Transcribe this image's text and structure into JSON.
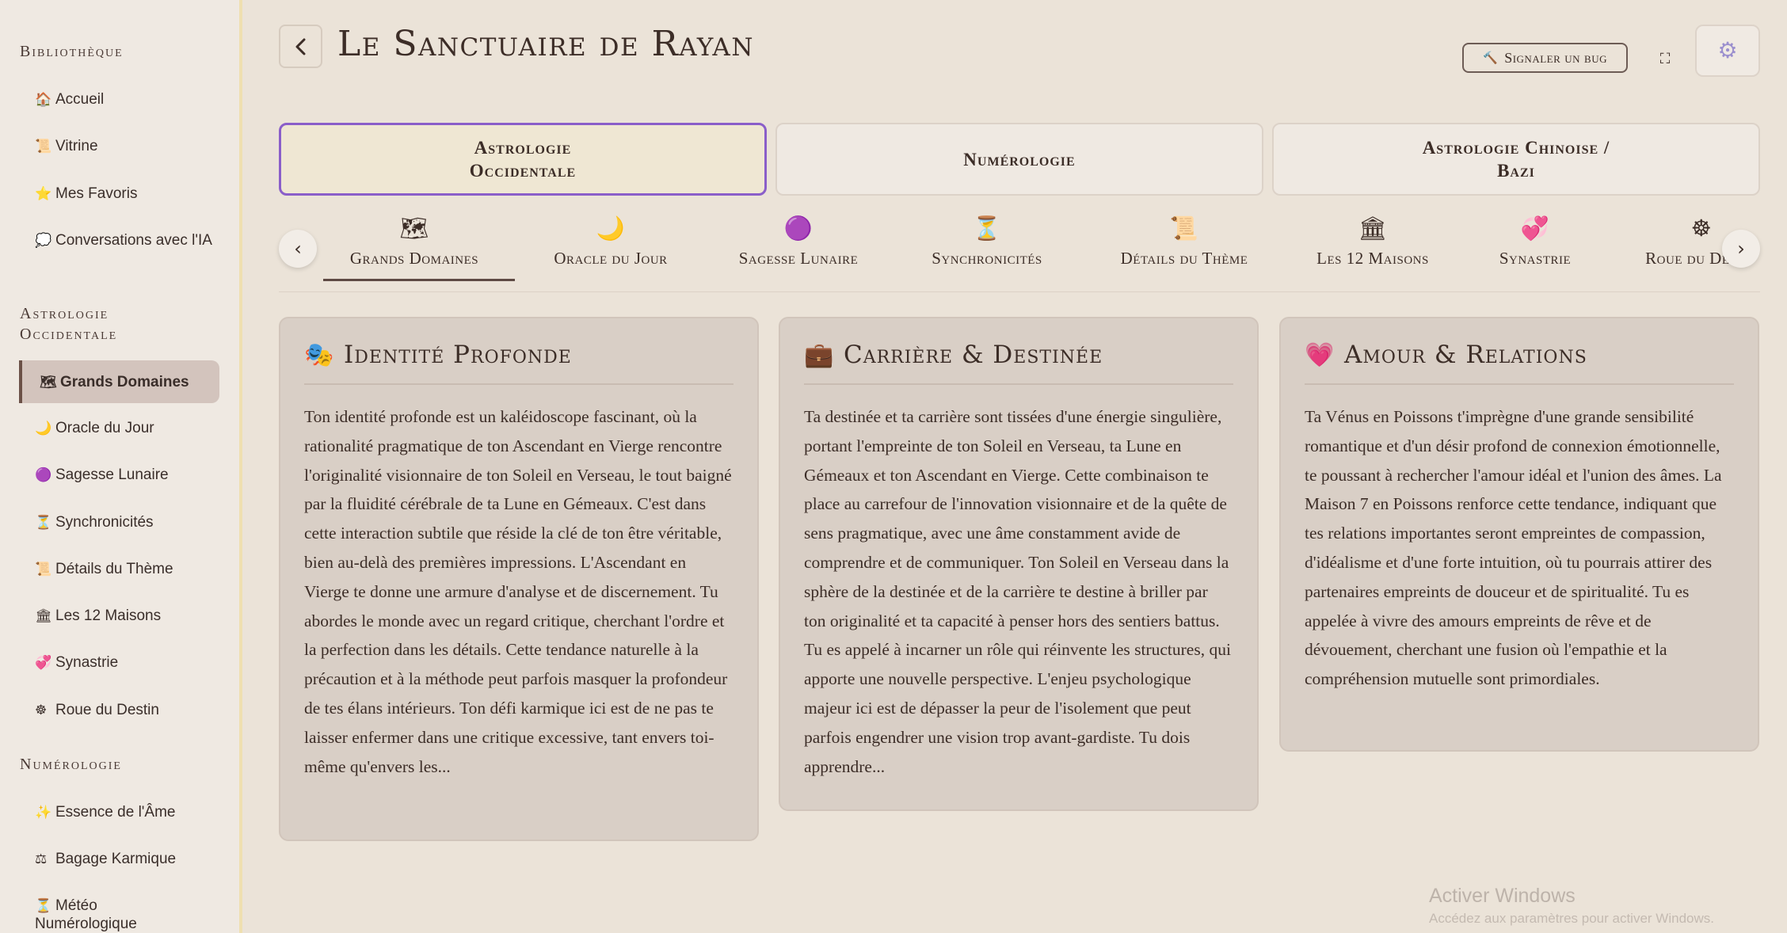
{
  "sidebar": {
    "sections": [
      {
        "title": "Bibliothèque"
      },
      {
        "title": "Astrologie Occidentale"
      },
      {
        "title": "Numérologie"
      }
    ],
    "items": [
      {
        "icon": "🏠",
        "label": "Accueil"
      },
      {
        "icon": "📜",
        "label": "Vitrine"
      },
      {
        "icon": "⭐",
        "label": "Mes Favoris"
      },
      {
        "icon": "💭",
        "label": "Conversations avec l'IA"
      },
      {
        "icon": "🗺",
        "label": "Grands Domaines"
      },
      {
        "icon": "🌙",
        "label": "Oracle du Jour"
      },
      {
        "icon": "🟣",
        "label": "Sagesse Lunaire"
      },
      {
        "icon": "⏳",
        "label": "Synchronicités"
      },
      {
        "icon": "📜",
        "label": "Détails du Thème"
      },
      {
        "icon": "🏛",
        "label": "Les 12 Maisons"
      },
      {
        "icon": "💞",
        "label": "Synastrie"
      },
      {
        "icon": "☸",
        "label": "Roue du Destin"
      },
      {
        "icon": "✨",
        "label": "Essence de l'Âme"
      },
      {
        "icon": "⚖",
        "label": "Bagage Karmique"
      },
      {
        "icon": "⏳",
        "label": "Météo Numérologique"
      }
    ]
  },
  "header": {
    "title": "Le Sanctuaire de Rayan",
    "bug_label": "Signaler un bug",
    "bug_icon": "🔨"
  },
  "main_tabs": [
    {
      "label": "Astrologie Occidentale"
    },
    {
      "label": "Numérologie"
    },
    {
      "label": "Astrologie Chinoise / Bazi"
    }
  ],
  "sub_tabs": [
    {
      "icon": "🗺",
      "label": "Grands Domaines"
    },
    {
      "icon": "🌙",
      "label": "Oracle du Jour"
    },
    {
      "icon": "🟣",
      "label": "Sagesse Lunaire"
    },
    {
      "icon": "⏳",
      "label": "Synchronicités"
    },
    {
      "icon": "📜",
      "label": "Détails du Thème"
    },
    {
      "icon": "🏛",
      "label": "Les 12 Maisons"
    },
    {
      "icon": "💞",
      "label": "Synastrie"
    },
    {
      "icon": "☸",
      "label": "Roue du Destin"
    }
  ],
  "cards": [
    {
      "icon": "🎭",
      "title": "Identité Profonde",
      "body": "Ton identité profonde est un kaléidoscope fascinant, où la rationalité pragmatique de ton Ascendant en Vierge rencontre l'originalité visionnaire de ton Soleil en Verseau, le tout baigné par la fluidité cérébrale de ta Lune en Gémeaux. C'est dans cette interaction subtile que réside la clé de ton être véritable, bien au-delà des premières impressions. L'Ascendant en Vierge te donne une armure d'analyse et de discernement. Tu abordes le monde avec un regard critique, cherchant l'ordre et la perfection dans les détails. Cette tendance naturelle à la précaution et à la méthode peut parfois masquer la profondeur de tes élans intérieurs. Ton défi karmique ici est de ne pas te laisser enfermer dans une critique excessive, tant envers toi-même qu'envers les..."
    },
    {
      "icon": "💼",
      "title": "Carrière & Destinée",
      "body": "Ta destinée et ta carrière sont tissées d'une énergie singulière, portant l'empreinte de ton Soleil en Verseau, ta Lune en Gémeaux et ton Ascendant en Vierge. Cette combinaison te place au carrefour de l'innovation visionnaire et de la quête de sens pragmatique, avec une âme constamment avide de comprendre et de communiquer. Ton Soleil en Verseau dans la sphère de la destinée et de la carrière te destine à briller par ton originalité et ta capacité à penser hors des sentiers battus. Tu es appelé à incarner un rôle qui réinvente les structures, qui apporte une nouvelle perspective. L'enjeu psychologique majeur ici est de dépasser la peur de l'isolement que peut parfois engendrer une vision trop avant-gardiste. Tu dois apprendre..."
    },
    {
      "icon": "💗",
      "title": "Amour & Relations",
      "body": "Ta Vénus en Poissons t'imprègne d'une grande sensibilité romantique et d'un désir profond de connexion émotionnelle, te poussant à rechercher l'amour idéal et l'union des âmes. La Maison 7 en Poissons renforce cette tendance, indiquant que tes relations importantes seront empreintes de compassion, d'idéalisme et d'une forte intuition, où tu pourrais attirer des partenaires empreints de douceur et de spiritualité. Tu es appelée à vivre des amours empreints de rêve et de dévouement, cherchant une fusion où l'empathie et la compréhension mutuelle sont primordiales."
    }
  ],
  "watermark": {
    "line1": "Activer Windows",
    "line2": "Accédez aux paramètres pour activer Windows."
  }
}
